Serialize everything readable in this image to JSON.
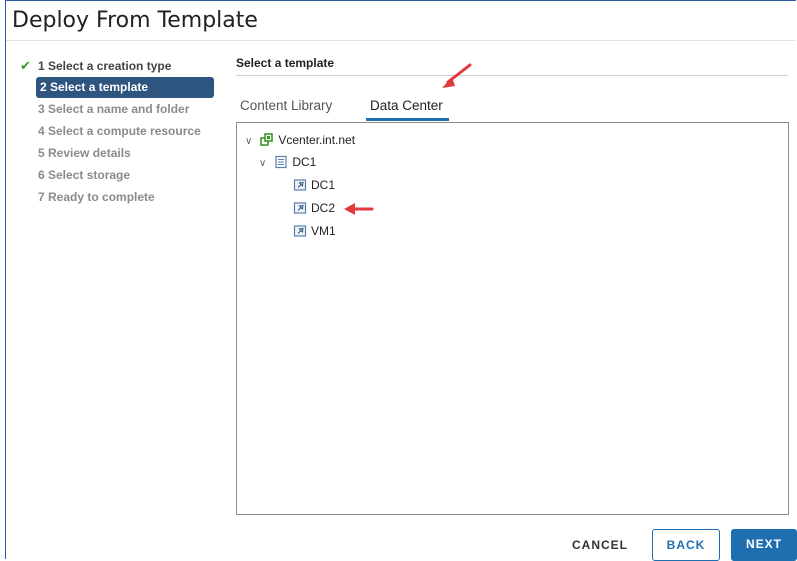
{
  "window": {
    "title": "Deploy From Template"
  },
  "steps": [
    {
      "label": "1 Select a creation type",
      "state": "done"
    },
    {
      "label": "2 Select a template",
      "state": "active"
    },
    {
      "label": "3 Select a name and folder",
      "state": "pending"
    },
    {
      "label": "4 Select a compute resource",
      "state": "pending"
    },
    {
      "label": "5 Review details",
      "state": "pending"
    },
    {
      "label": "6 Select storage",
      "state": "pending"
    },
    {
      "label": "7 Ready to complete",
      "state": "pending"
    }
  ],
  "section": {
    "title": "Select a template"
  },
  "tabs": [
    {
      "label": "Content Library",
      "selected": false
    },
    {
      "label": "Data Center",
      "selected": true
    }
  ],
  "tree": {
    "root": {
      "label": "Vcenter.int.net",
      "icon": "vcenter-icon",
      "expanded": true
    },
    "datacenter": {
      "label": "DC1",
      "icon": "datacenter-icon",
      "expanded": true
    },
    "templates": [
      {
        "label": "DC1",
        "icon": "vm-template-icon"
      },
      {
        "label": "DC2",
        "icon": "vm-template-icon"
      },
      {
        "label": "VM1",
        "icon": "vm-template-icon"
      }
    ]
  },
  "buttons": {
    "cancel": "CANCEL",
    "back": "BACK",
    "next": "NEXT"
  },
  "colors": {
    "accent": "#1f6fb0",
    "active_step": "#2e557f",
    "check": "#3e9b2e",
    "annotation_arrow": "#e0393e"
  }
}
